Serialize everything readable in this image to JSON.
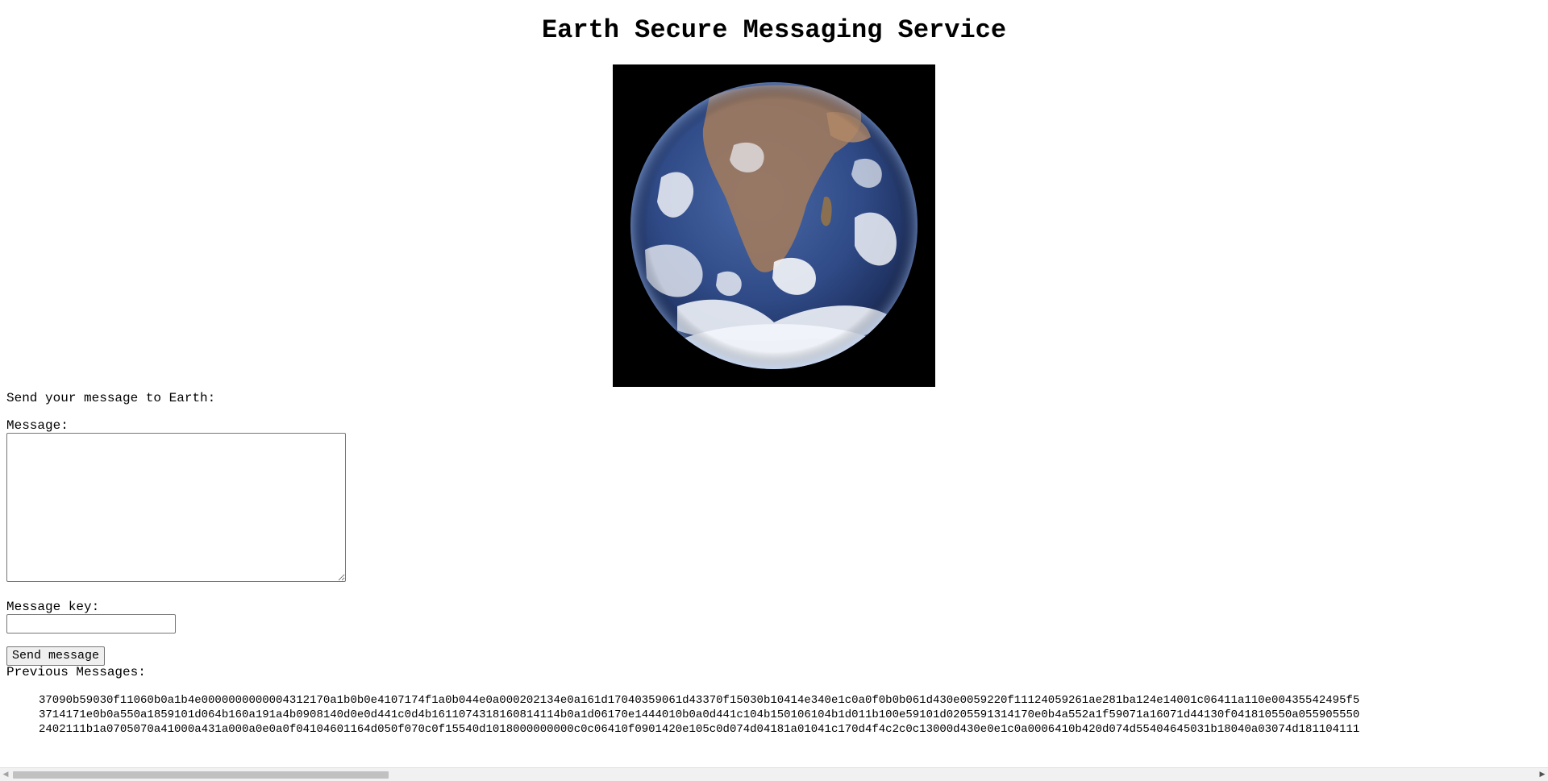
{
  "page": {
    "title": "Earth Secure Messaging Service"
  },
  "image": {
    "alt": "Earth"
  },
  "form": {
    "heading": "Send your message to Earth:",
    "message_label": "Message:",
    "message_value": "",
    "key_label": "Message key:",
    "key_value": "",
    "send_label": "Send message"
  },
  "previous": {
    "label": "Previous Messages:",
    "messages": [
      "37090b59030f11060b0a1b4e0000000000004312170a1b0b0e4107174f1a0b044e0a000202134e0a161d17040359061d43370f15030b10414e340e1c0a0f0b0b061d430e0059220f11124059261ae281ba124e14001c06411a110e00435542495f5",
      "3714171e0b0a550a1859101d064b160a191a4b0908140d0e0d441c0d4b1611074318160814114b0a1d06170e1444010b0a0d441c104b150106104b1d011b100e59101d0205591314170e0b4a552a1f59071a16071d44130f041810550a055905550",
      "2402111b1a0705070a41000a431a000a0e0a0f04104601164d050f070c0f15540d1018000000000c0c06410f0901420e105c0d074d04181a01041c170d4f4c2c0c13000d430e0e1c0a0006410b420d074d55404645031b18040a03074d181104111"
    ]
  },
  "colors": {
    "background": "#ffffff",
    "image_background": "#000000",
    "scrollbar_track": "#f1f1f1",
    "scrollbar_thumb": "#c1c1c1"
  }
}
